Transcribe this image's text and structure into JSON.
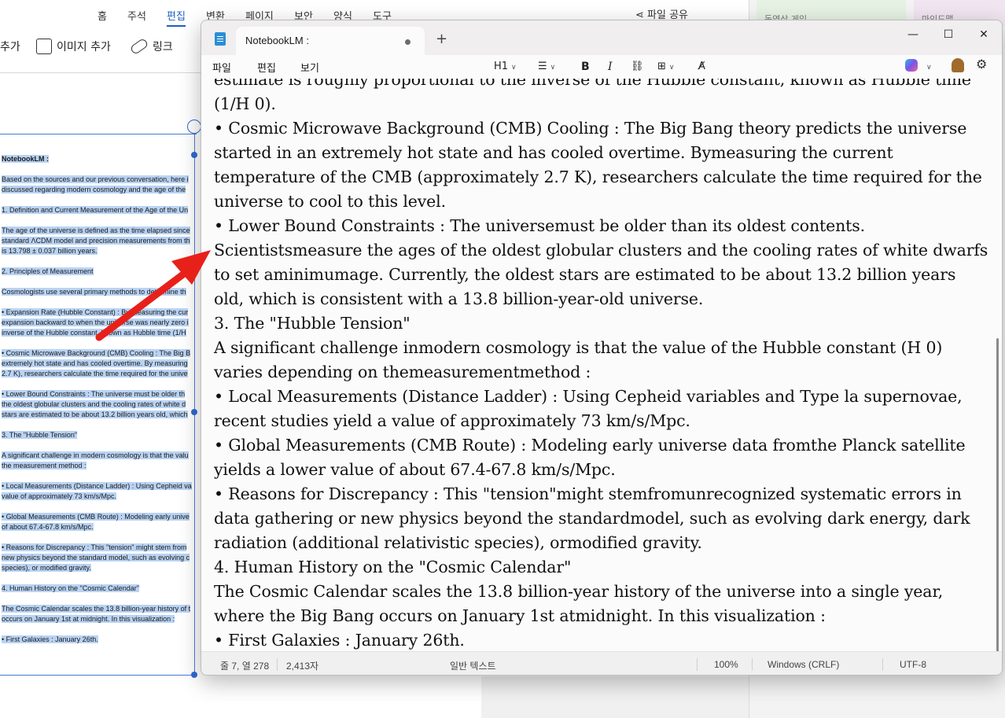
{
  "background_app": {
    "menu": [
      "홈",
      "주석",
      "편집",
      "변환",
      "페이지",
      "보안",
      "양식",
      "도구"
    ],
    "active_menu": "편집",
    "share_label": "파일 공유",
    "toolbar": {
      "add_partial": "추가",
      "add_image": "이미지 추가",
      "link": "링크"
    },
    "right_cards": [
      "동영상 게임",
      "마인드맵"
    ],
    "doc_lines": [
      {
        "text": "NotebookLM :",
        "bold": true
      },
      {
        "text": "",
        "bold": false
      },
      {
        "text": "Based on the sources and our previous conversation, here i",
        "bold": false
      },
      {
        "text": "discussed regarding modern cosmology and the age of the",
        "bold": false
      },
      {
        "text": "",
        "bold": false
      },
      {
        "text": "1. Definition and Current Measurement of the Age of the Un",
        "bold": false
      },
      {
        "text": "",
        "bold": false
      },
      {
        "text": "The age of the universe is defined as the time elapsed since",
        "bold": false
      },
      {
        "text": "standard ΛCDM model and precision measurements from th",
        "bold": false
      },
      {
        "text": "is 13.798 ± 0.037 billion years.",
        "bold": false
      },
      {
        "text": "",
        "bold": false
      },
      {
        "text": "2. Principles of Measurement",
        "bold": false
      },
      {
        "text": "",
        "bold": false
      },
      {
        "text": "Cosmologists use several primary methods to determine th",
        "bold": false
      },
      {
        "text": "",
        "bold": false
      },
      {
        "text": "• Expansion Rate (Hubble Constant) : By measuring the cur",
        "bold": false
      },
      {
        "text": "expansion backward to when the universe was nearly zero i",
        "bold": false
      },
      {
        "text": "inverse of the Hubble constant, known as Hubble time (1/H",
        "bold": false
      },
      {
        "text": "",
        "bold": false
      },
      {
        "text": "• Cosmic Microwave Background (CMB) Cooling : The Big B",
        "bold": false
      },
      {
        "text": "extremely hot state and has cooled overtime. By measuring",
        "bold": false
      },
      {
        "text": "2.7 K), researchers calculate the time required for the unive",
        "bold": false
      },
      {
        "text": "",
        "bold": false
      },
      {
        "text": "• Lower Bound Constraints : The universe must be older th",
        "bold": false
      },
      {
        "text": "the oldest globular clusters and the cooling rates of white d",
        "bold": false
      },
      {
        "text": "stars are estimated to be about 13.2 billion years old, which",
        "bold": false
      },
      {
        "text": "",
        "bold": false
      },
      {
        "text": "3. The \"Hubble Tension\"",
        "bold": false
      },
      {
        "text": "",
        "bold": false
      },
      {
        "text": "A significant challenge in modern cosmology is that the valu",
        "bold": false
      },
      {
        "text": "the measurement method :",
        "bold": false
      },
      {
        "text": "",
        "bold": false
      },
      {
        "text": "• Local Measurements (Distance Ladder) : Using Cepheid va",
        "bold": false
      },
      {
        "text": "value of approximately 73 km/s/Mpc.",
        "bold": false
      },
      {
        "text": "",
        "bold": false
      },
      {
        "text": "• Global Measurements (CMB Route) : Modeling early unive",
        "bold": false
      },
      {
        "text": "of about 67.4-67.8 km/s/Mpc.",
        "bold": false
      },
      {
        "text": "",
        "bold": false
      },
      {
        "text": "• Reasons for Discrepancy : This \"tension\" might stem from",
        "bold": false
      },
      {
        "text": "new physics beyond the standard model, such as evolving c",
        "bold": false
      },
      {
        "text": "species), or modified gravity.",
        "bold": false
      },
      {
        "text": "",
        "bold": false
      },
      {
        "text": "4. Human History on the \"Cosmic Calendar\"",
        "bold": false
      },
      {
        "text": "",
        "bold": false
      },
      {
        "text": "The Cosmic Calendar scales the 13.8 billion-year history of t",
        "bold": false
      },
      {
        "text": "occurs on January 1st at midnight. In this visualization :",
        "bold": false
      },
      {
        "text": "",
        "bold": false
      },
      {
        "text": "• First Galaxies : January 26th.",
        "bold": false
      }
    ]
  },
  "notepad": {
    "tab_title": "NotebookLM :",
    "new_tab": "+",
    "window_controls": {
      "minimize": "—",
      "maximize": "☐",
      "close": "✕"
    },
    "menu": [
      "파일",
      "편집",
      "보기"
    ],
    "format_toolbar": {
      "heading": "H1",
      "bold": "B",
      "italic": "I"
    },
    "lines": [
      "estimate is roughly proportional to the inverse of the Hubble constant, known as Hubble time",
      "(1/H 0).",
      " • Cosmic Microwave Background (CMB) Cooling : The Big Bang theory predicts the universe",
      "started in an extremely hot state and has cooled overtime. Bymeasuring the current",
      "temperature of the CMB (approximately 2.7 K), researchers calculate the time required for the",
      "universe to cool to this level.",
      " •  Lower Bound Constraints : The universemust be older than its oldest contents.",
      "Scientistsmeasure the ages of the oldest globular clusters and the cooling rates of white dwarfs",
      "to set aminimumage. Currently, the oldest stars are estimated to be about 13.2 billion years",
      "old, which is consistent with a 13.8 billion-year-old universe.",
      "3. The \"Hubble Tension\"",
      "A significant challenge inmodern cosmology is that the value of the Hubble constant (H 0)",
      "varies depending on themeasurementmethod :",
      " •  Local Measurements (Distance Ladder) : Using Cepheid variables and Type la supernovae,",
      "recent studies yield a value of approximately 73 km/s/Mpc.",
      " •  Global Measurements (CMB Route) : Modeling early universe data fromthe Planck satellite",
      "yields a lower value of about 67.4-67.8 km/s/Mpc.",
      " •  Reasons for Discrepancy : This \"tension\"might stemfromunrecognized systematic errors in",
      "data gathering or new physics beyond the standardmodel, such as evolving dark energy, dark",
      "radiation (additional relativistic species), ormodified gravity.",
      "4. Human History on the \"Cosmic Calendar\"",
      "The Cosmic Calendar scales the 13.8 billion-year history of the universe into a single year,",
      "where the Big Bang occurs on January 1st atmidnight. In this visualization :",
      " •  First Galaxies : January 26th."
    ],
    "status": {
      "position": "줄 7, 열 278",
      "chars": "2,413자",
      "mode": "일반 텍스트",
      "zoom": "100%",
      "line_ending": "Windows (CRLF)",
      "encoding": "UTF-8"
    }
  },
  "colors": {
    "annotation_arrow": "#e8201a",
    "selection": "#b9d3f3",
    "accent": "#1f5fbf"
  }
}
